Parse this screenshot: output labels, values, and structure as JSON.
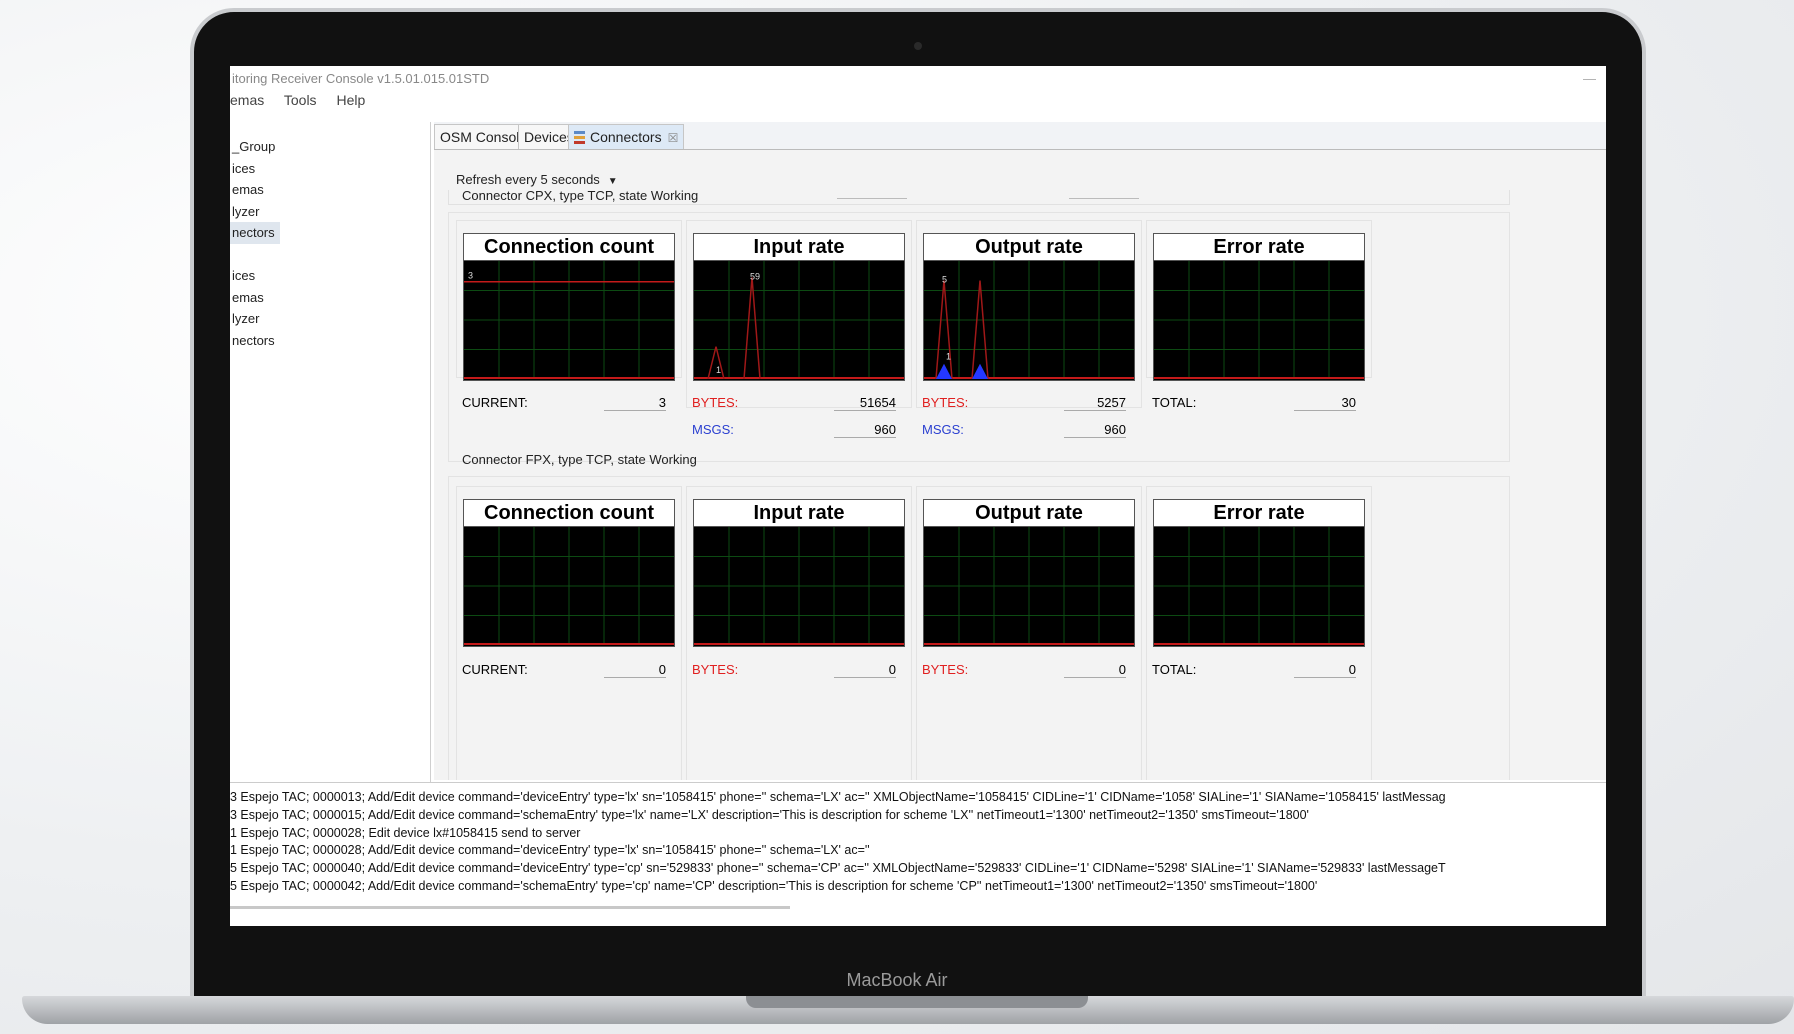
{
  "device_label": "MacBook Air",
  "app": {
    "title": "itoring Receiver Console v1.5.01.015.01STD",
    "minimize_glyph": "—",
    "menu": [
      "emas",
      "Tools",
      "Help"
    ]
  },
  "sidebar": {
    "items_top": [
      "_Group",
      "ices",
      "emas",
      "lyzer",
      "nectors"
    ],
    "items_bottom": [
      "ices",
      "emas",
      "lyzer",
      "nectors"
    ]
  },
  "tabs": [
    {
      "label": "OSM Console",
      "active": false
    },
    {
      "label": "Devices",
      "active": false
    },
    {
      "label": "Connectors",
      "active": true,
      "icon": "connectors-icon",
      "close": "☒"
    }
  ],
  "refresh": {
    "label": "Refresh every 5 seconds",
    "arrow": "▼"
  },
  "connectors": [
    {
      "title": "Connector CPX, type TCP, state Working",
      "charts": {
        "connection": {
          "title": "Connection count",
          "peak_label": "3",
          "level": 3,
          "max": 3.4
        },
        "input": {
          "title": "Input rate",
          "peaks": [
            {
              "v": 18
            },
            {
              "v": 59,
              "label": "59"
            }
          ],
          "min_label": "1",
          "max": 64
        },
        "output": {
          "title": "Output rate",
          "peaks": [
            {
              "v": 5,
              "label": "5"
            },
            {
              "v": 5
            }
          ],
          "blue": [
            {
              "v": 1,
              "label": "1"
            },
            {
              "v": 1
            }
          ],
          "max": 5.6
        },
        "error": {
          "title": "Error rate"
        }
      },
      "metrics": {
        "current_label": "CURRENT:",
        "current": "3",
        "input_bytes_label": "BYTES:",
        "input_bytes": "51654",
        "input_msgs_label": "MSGS:",
        "input_msgs": "960",
        "output_bytes_label": "BYTES:",
        "output_bytes": "5257",
        "output_msgs_label": "MSGS:",
        "output_msgs": "960",
        "total_label": "TOTAL:",
        "total": "30"
      }
    },
    {
      "title": "Connector FPX, type TCP, state Working",
      "charts": {
        "connection": {
          "title": "Connection count"
        },
        "input": {
          "title": "Input rate"
        },
        "output": {
          "title": "Output rate"
        },
        "error": {
          "title": "Error rate"
        }
      },
      "metrics": {
        "current_label": "CURRENT:",
        "current": "0",
        "input_bytes_label": "BYTES:",
        "input_bytes": "0",
        "output_bytes_label": "BYTES:",
        "output_bytes": "0",
        "total_label": "TOTAL:",
        "total": "0"
      }
    }
  ],
  "log": [
    "3  Espejo TAC; 0000013; Add/Edit device command='deviceEntry' type='lx' sn='1058415' phone='' schema='LX' ac='' XMLObjectName='1058415' CIDLine='1' CIDName='1058' SIALine='1' SIAName='1058415' lastMessag",
    "3  Espejo TAC; 0000015; Add/Edit device command='schemaEntry' type='lx' name='LX' description='This is description for scheme 'LX'' netTimeout1='1300' netTimeout2='1350' smsTimeout='1800'",
    "1  Espejo TAC; 0000028; Edit device lx#1058415 send to server",
    "1  Espejo TAC; 0000028; Add/Edit device command='deviceEntry' type='lx' sn='1058415' phone='' schema='LX' ac=''",
    "5  Espejo TAC; 0000040; Add/Edit device command='deviceEntry' type='cp' sn='529833' phone='' schema='CP' ac='' XMLObjectName='529833' CIDLine='1' CIDName='5298' SIALine='1' SIAName='529833' lastMessageT",
    "5  Espejo TAC; 0000042; Add/Edit device command='schemaEntry' type='cp' name='CP' description='This is description for scheme 'CP'' netTimeout1='1300' netTimeout2='1350' smsTimeout='1800'"
  ]
}
